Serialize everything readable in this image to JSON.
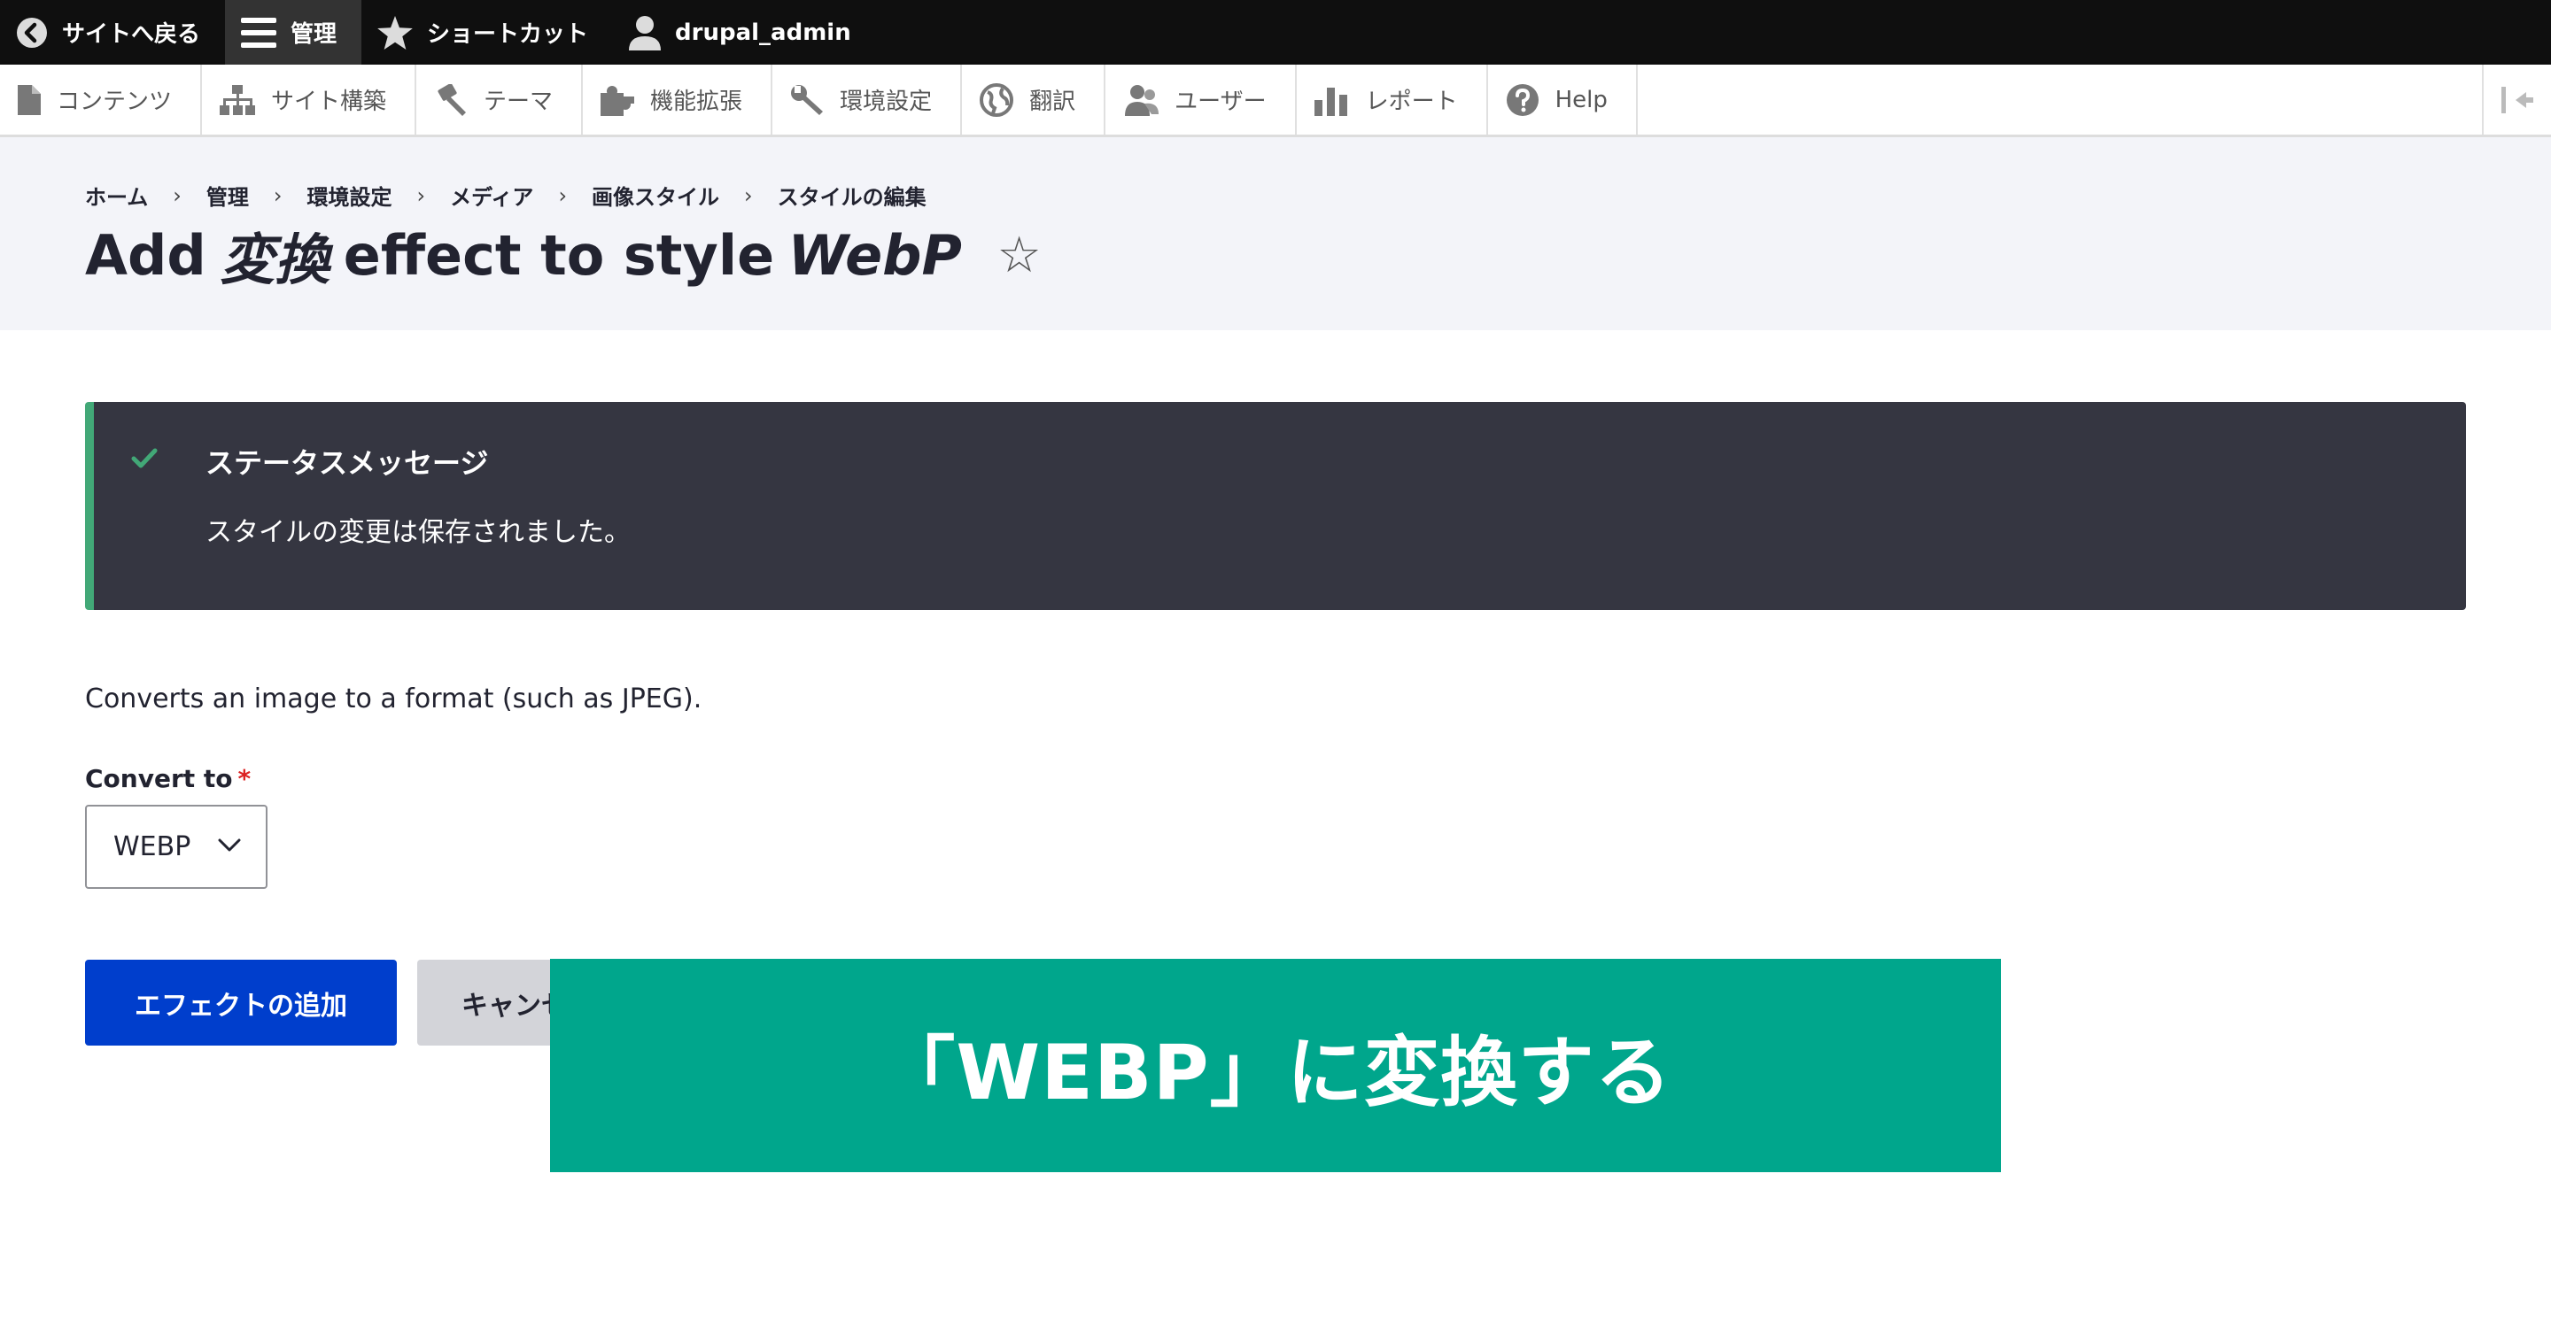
{
  "toolbar": {
    "back_label": "サイトへ戻る",
    "manage_label": "管理",
    "shortcuts_label": "ショートカット",
    "user_label": "drupal_admin"
  },
  "tray": {
    "items": [
      {
        "label": "コンテンツ",
        "icon": "file-icon"
      },
      {
        "label": "サイト構築",
        "icon": "sitemap-icon"
      },
      {
        "label": "テーマ",
        "icon": "paintbrush-icon"
      },
      {
        "label": "機能拡張",
        "icon": "puzzle-icon"
      },
      {
        "label": "環境設定",
        "icon": "wrench-icon"
      },
      {
        "label": "翻訳",
        "icon": "globe-icon"
      },
      {
        "label": "ユーザー",
        "icon": "users-icon"
      },
      {
        "label": "レポート",
        "icon": "bar-chart-icon"
      },
      {
        "label": "Help",
        "icon": "help-icon"
      }
    ]
  },
  "breadcrumb": [
    "ホーム",
    "管理",
    "環境設定",
    "メディア",
    "画像スタイル",
    "スタイルの編集"
  ],
  "page_title": {
    "prefix": "Add",
    "effect": "変換",
    "middle": "effect to style",
    "style": "WebP",
    "star": "☆"
  },
  "status": {
    "title": "ステータスメッセージ",
    "message": "スタイルの変更は保存されました。"
  },
  "form": {
    "description": "Converts an image to a format (such as JPEG).",
    "label": "Convert to",
    "required_mark": "*",
    "select_value": "WEBP",
    "submit_label": "エフェクトの追加",
    "cancel_label": "キャンセル"
  },
  "banner": {
    "text": "「WEBP」に変換する"
  },
  "colors": {
    "toolbar_bg": "#0f0f0f",
    "status_bg": "#353641",
    "status_accent": "#42a877",
    "primary_button": "#003ecc",
    "banner_bg": "#00a68c"
  }
}
